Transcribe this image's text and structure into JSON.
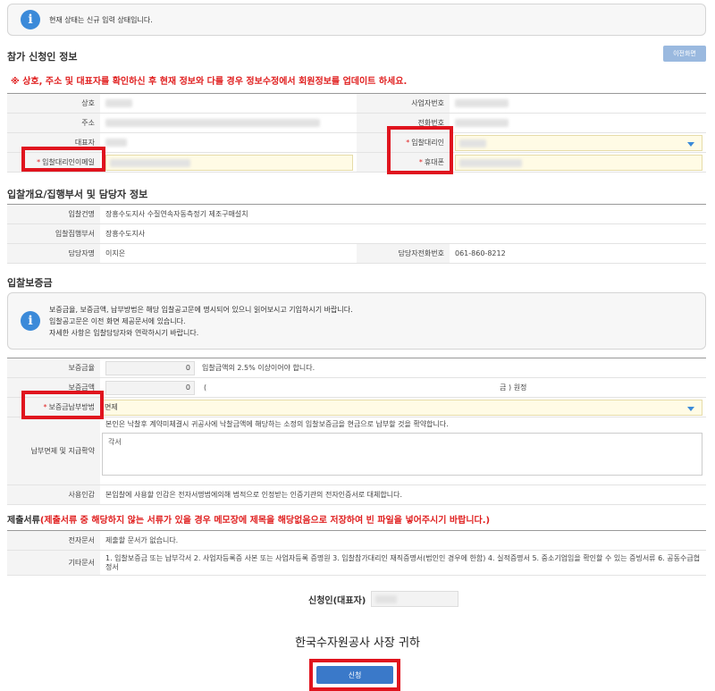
{
  "notice_top": "현재 상태는 신규 입력 상태입니다.",
  "section1": {
    "title": "참가 신청인 정보",
    "prev_button": "이전화면",
    "warning": "※ 상호, 주소 및 대표자를 확인하신 후 현재 정보와 다를 경우 정보수정에서 회원정보를 업데이트 하세요.",
    "labels": {
      "company": "상호",
      "biz_no": "사업자번호",
      "address": "주소",
      "phone": "전화번호",
      "ceo": "대표자",
      "agent": "입찰대리인",
      "agent_email": "입찰대리인이메일",
      "mobile": "휴대폰"
    }
  },
  "section2": {
    "title": "입찰개요/집행부서 및 담당자 정보",
    "labels": {
      "name": "입찰건명",
      "dept": "입찰집행부서",
      "manager": "담당자명",
      "manager_phone": "담당자전화번호"
    },
    "values": {
      "name": "장흥수도지사 수질연속자동측정기 제조구매설치",
      "dept": "장흥수도지사",
      "manager": "이지은",
      "manager_phone": "061-860-8212"
    }
  },
  "section3": {
    "title": "입찰보증금",
    "notice_lines": [
      "보증금율, 보증금액, 납부방법은 해당 입찰공고문에 명시되어 있으니 읽어보시고 기입하시기 바랍니다.",
      "입찰공고문은 이전 화면 제공문서에 있습니다.",
      "자세한 사항은 입찰담당자와 연락하시기 바랍니다."
    ],
    "labels": {
      "rate": "보증금율",
      "amount": "보증금액",
      "method": "보증금납부방법",
      "pledge": "납부면제 및 지급확약",
      "seal": "사용인감"
    },
    "rate_value": "0",
    "rate_note": "입찰금액의 2.5% 이상이어야 합니다.",
    "amount_value": "0",
    "amount_open": "(",
    "amount_close": "금 ) 원정",
    "method_value": "면제",
    "pledge_text": "본인은 낙찰후 계약미체결시 귀공사에 낙찰금액에 해당하는 소정의 입찰보증금을 현금으로 납부할 것을 확약합니다.",
    "pledge_input": "각서",
    "seal_text": "본입찰에 사용할 인감은 전자서명법에의해 법적으로 인정받는 인증기관의 전자인증서로 대체합니다."
  },
  "section4": {
    "title_prefix": "제출서류",
    "title_red": "(제출서류 중 해당하지 않는 서류가 있을 경우 메모장에 제목을 해당없음으로 저장하여 빈 파일을 넣어주시기 바랍니다.)",
    "labels": {
      "edoc": "전자문서",
      "other": "기타문서"
    },
    "edoc_value": "제출할 문서가 없습니다.",
    "other_value": "1. 입찰보증금 또는 납부각서 2. 사업자등록증 사본 또는 사업자등록 증명원 3. 입찰참가대리인 재직증명서(법인인 경우에 한함) 4. 실적증명서 5. 중소기업임을 확인할 수 있는 증빙서류 6. 공동수급협정서"
  },
  "signer_label": "신청인(대표자)",
  "addressee": "한국수자원공사 사장 귀하",
  "submit_label": "신청"
}
